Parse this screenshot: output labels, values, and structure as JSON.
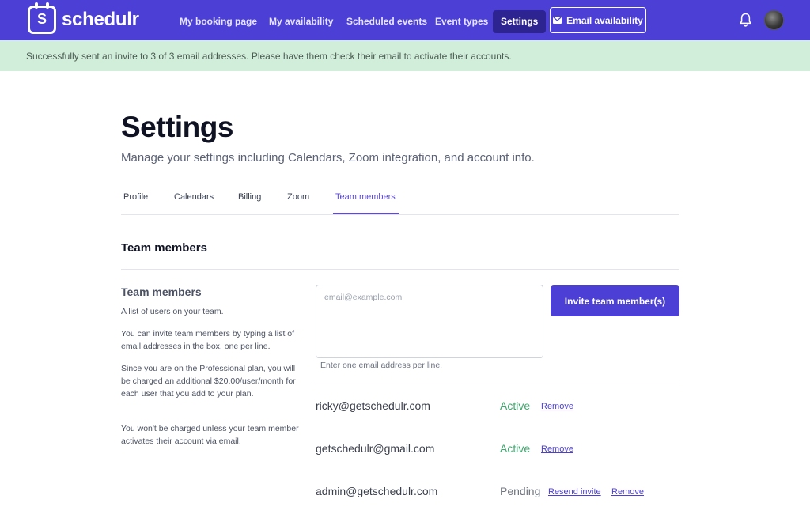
{
  "brand": {
    "name": "schedulr",
    "mark": "S"
  },
  "nav": {
    "items": [
      {
        "label": "My booking page"
      },
      {
        "label": "My availability"
      },
      {
        "label": "Scheduled events"
      },
      {
        "label": "Event types"
      },
      {
        "label": "Settings",
        "active": true
      }
    ],
    "email_button_label": "Email availability",
    "icons": [
      "envelope-icon",
      "bell-icon",
      "avatar"
    ]
  },
  "alert": {
    "text": "Successfully sent an invite to 3 of 3 email addresses. Please have them check their email to activate their accounts."
  },
  "page": {
    "title": "Settings",
    "subtitle": "Manage your settings including Calendars, Zoom integration, and account info."
  },
  "tabs": [
    {
      "label": "Profile"
    },
    {
      "label": "Calendars"
    },
    {
      "label": "Billing"
    },
    {
      "label": "Zoom"
    },
    {
      "label": "Team members",
      "active": true
    }
  ],
  "section": {
    "title": "Team members",
    "side_title": "Team members",
    "paragraphs": [
      "A list of users on your team.",
      "You can invite team members by typing a list of email addresses in the box, one per line.",
      "Since you are on the Professional plan, you will be charged an additional $20.00/user/month for each user that you add to your plan.",
      "You won't be charged unless your team member activates their account via email."
    ]
  },
  "invite": {
    "placeholder": "email@example.com",
    "value": "",
    "hint": "Enter one email address per line.",
    "button_label": "Invite team member(s)"
  },
  "members": [
    {
      "email": "ricky@getschedulr.com",
      "status": "Active",
      "actions": [
        "Remove"
      ]
    },
    {
      "email": "getschedulr@gmail.com",
      "status": "Active",
      "actions": [
        "Remove"
      ]
    },
    {
      "email": "admin@getschedulr.com",
      "status": "Pending",
      "actions": [
        "Resend invite",
        "Remove"
      ]
    }
  ],
  "colors": {
    "brand": "#4b3fd6",
    "alert_bg": "#d1eedb",
    "active_status": "#3ea86d",
    "pending_status": "#70757f"
  }
}
